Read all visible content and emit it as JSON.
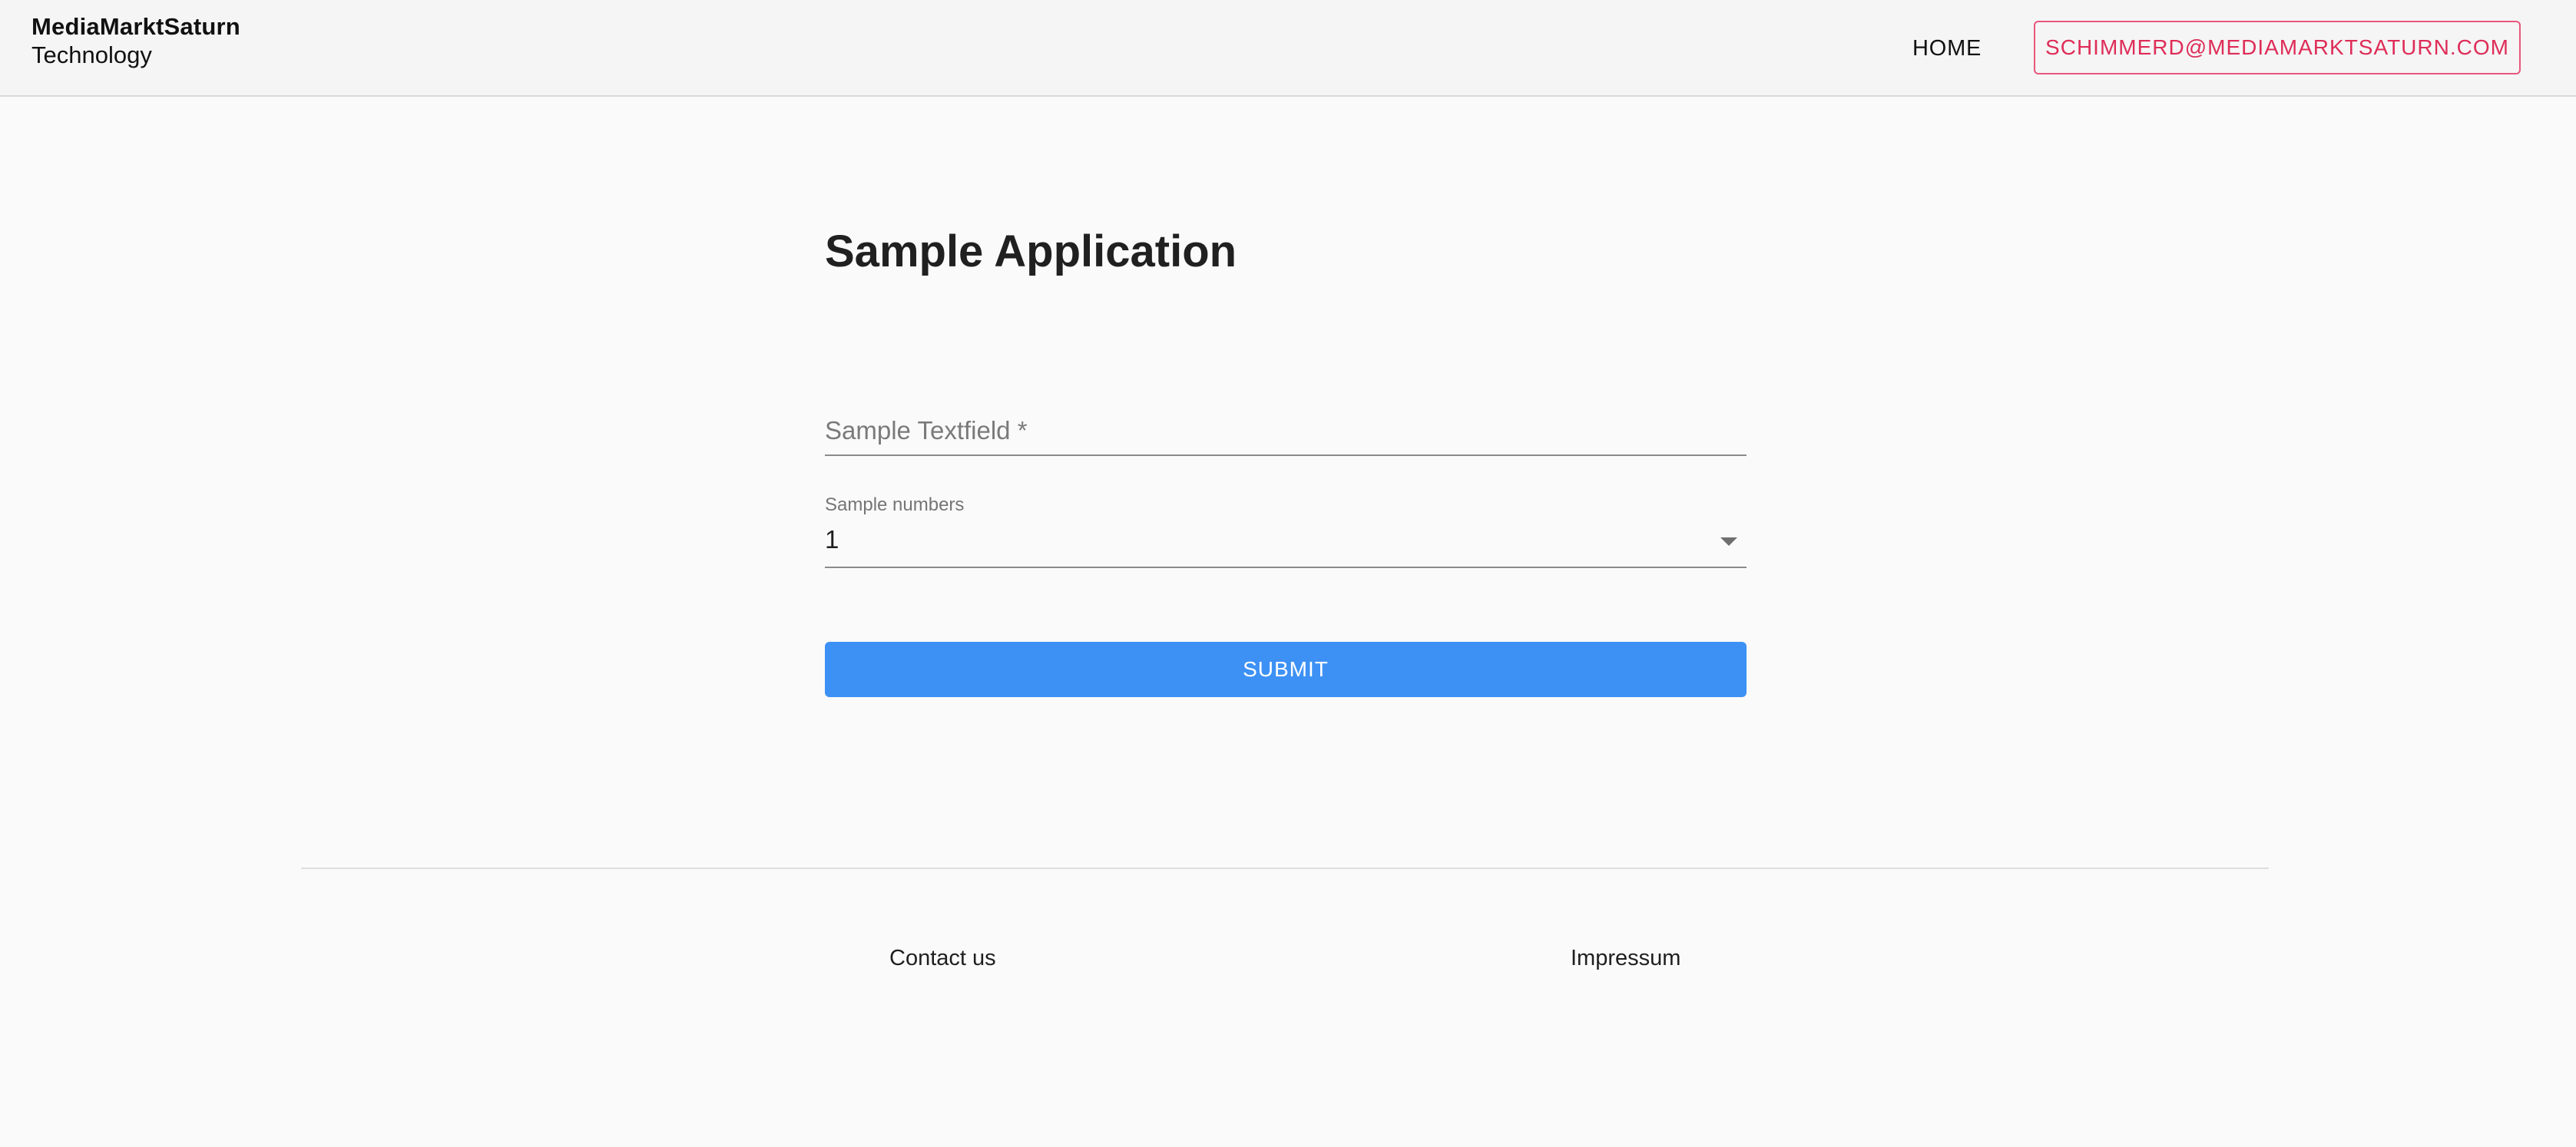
{
  "header": {
    "brand_line1": "MediaMarktSaturn",
    "brand_line2": "Technology",
    "nav_home": "HOME",
    "user_email": "SCHIMMERD@MEDIAMARKTSATURN.COM"
  },
  "main": {
    "title": "Sample Application",
    "text_field": {
      "label": "Sample Textfield *",
      "value": ""
    },
    "select": {
      "label": "Sample numbers",
      "value": "1"
    },
    "submit_label": "SUBMIT"
  },
  "footer": {
    "contact": "Contact us",
    "impressum": "Impressum"
  },
  "colors": {
    "accent_blue": "#3d91f4",
    "user_button_red": "#de2d58",
    "header_bg": "#f5f5f5",
    "page_bg": "#fafafa"
  }
}
